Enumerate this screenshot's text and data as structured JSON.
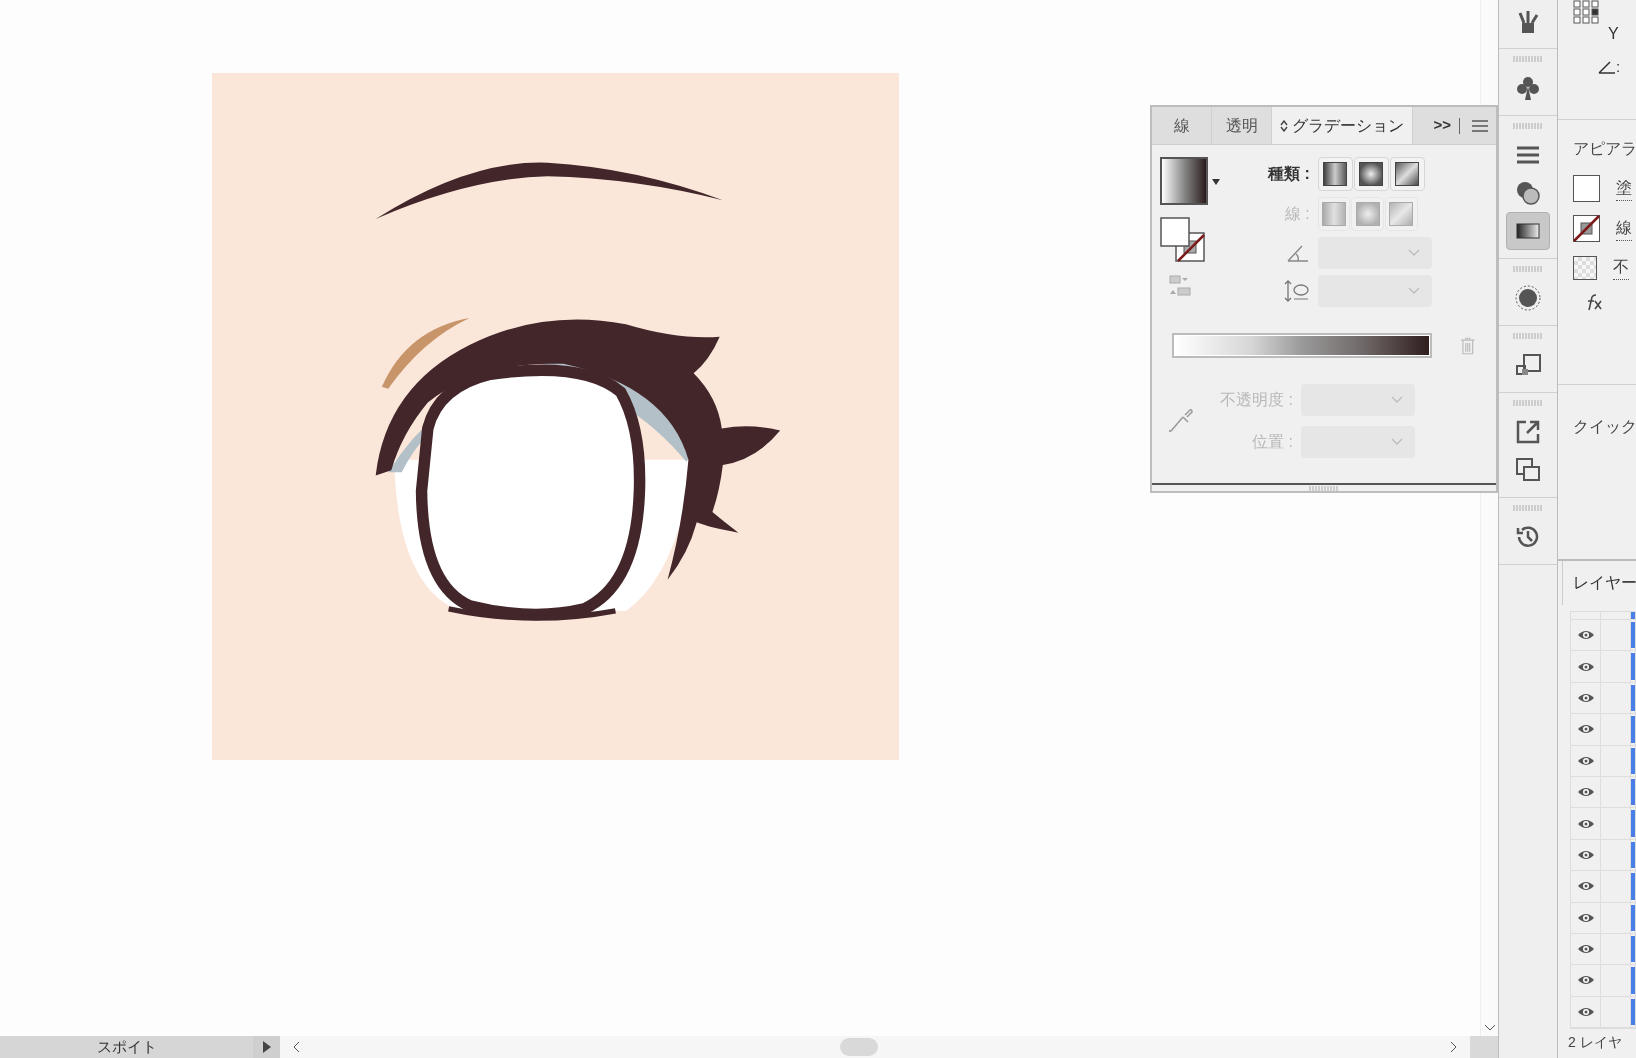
{
  "gradient_panel": {
    "tabs": [
      {
        "label": "線",
        "selected": false
      },
      {
        "label": "透明",
        "selected": false
      },
      {
        "label": "グラデーション",
        "selected": true
      }
    ],
    "more_label": ">>",
    "type_row": {
      "label": "種類 :",
      "disabled": false
    },
    "stroke_row": {
      "label": "線 :",
      "disabled": true
    },
    "opacity_row": {
      "label": "不透明度 :",
      "disabled": true
    },
    "location_row": {
      "label": "位置 :",
      "disabled": true
    }
  },
  "status_bar": {
    "tool": "スポイト"
  },
  "properties_panel": {
    "y_label": "Y",
    "angle_suffix": ":",
    "appearance_title": "アピアラ",
    "appearance_rows": [
      {
        "kind": "fill",
        "label": "塗"
      },
      {
        "kind": "stroke",
        "label": "線"
      },
      {
        "kind": "opacity",
        "label": "不"
      }
    ],
    "quick_actions_title": "クイック"
  },
  "layers_panel": {
    "tab": "レイヤー",
    "rows": [
      {
        "visible": true
      },
      {
        "visible": true
      },
      {
        "visible": true
      },
      {
        "visible": true
      },
      {
        "visible": true
      },
      {
        "visible": true
      },
      {
        "visible": true
      },
      {
        "visible": true
      },
      {
        "visible": true
      },
      {
        "visible": true
      },
      {
        "visible": true
      },
      {
        "visible": true
      },
      {
        "visible": true
      }
    ],
    "footer": "2 レイヤ"
  }
}
